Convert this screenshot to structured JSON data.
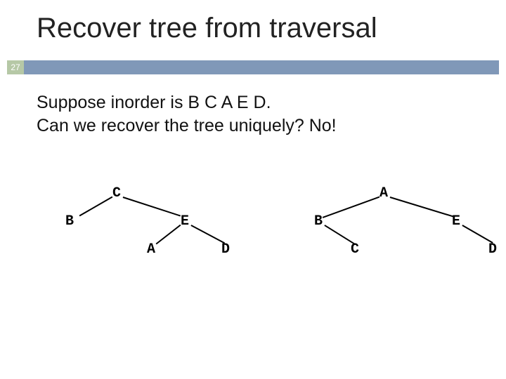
{
  "slide": {
    "title": "Recover tree from traversal",
    "page_number": "27",
    "body_line1": "Suppose inorder is B C A E D.",
    "body_line2": "Can we recover the tree uniquely? No!"
  },
  "tree_left": {
    "root": "C",
    "l": "B",
    "r": "E",
    "rl": "A",
    "rr": "D"
  },
  "tree_right": {
    "root": "A",
    "l": "B",
    "r": "E",
    "lr": "C",
    "rr": "D"
  }
}
